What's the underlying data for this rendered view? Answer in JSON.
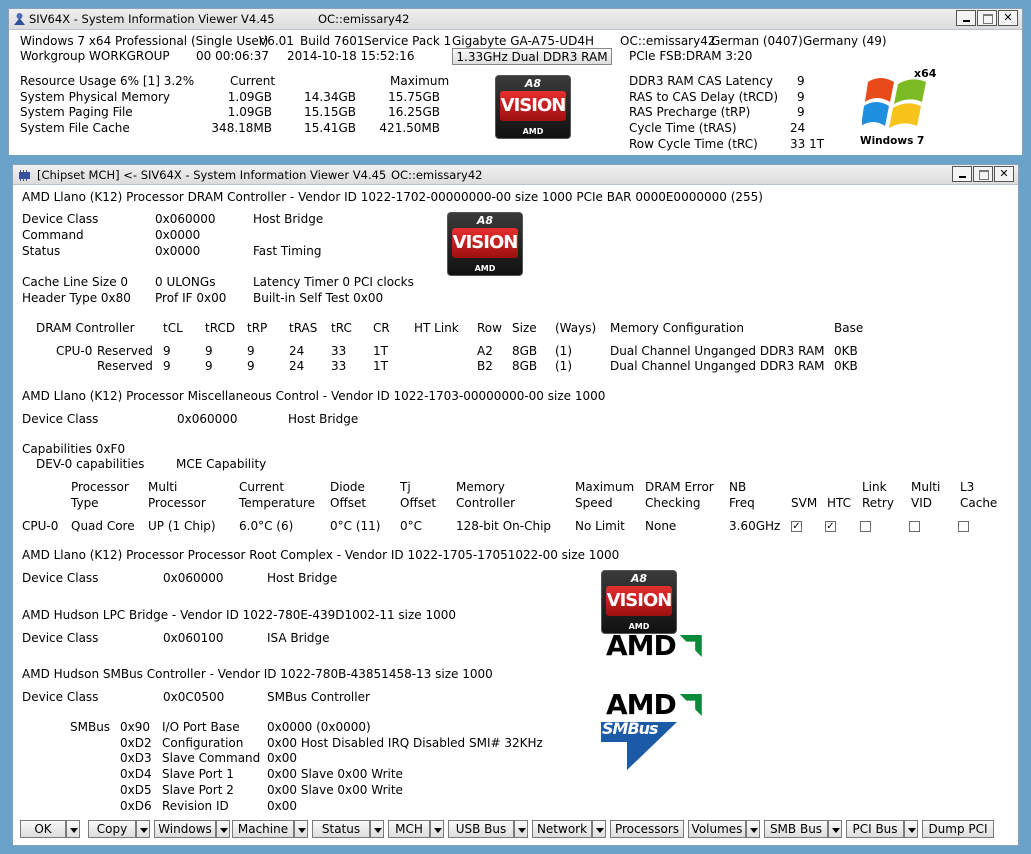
{
  "main_window": {
    "title": "SIV64X - System Information Viewer V4.45",
    "title_oc": "OC::emissary42",
    "os": "Windows 7 x64 Professional (Single User)",
    "version": "V6.01",
    "build": "Build 7601",
    "sp": "Service Pack 1",
    "board": "Gigabyte GA-A75-UD4H",
    "oc_user": "OC::emissary42",
    "lang": "German (0407)",
    "country": "Germany (49)",
    "workgroup": "Workgroup WORKGROUP",
    "uptime": "00 00:06:37",
    "date": "2014-10-18 15:52:16",
    "ram_button": "1.33GHz Dual DDR3 RAM",
    "pcie": "PCIe FSB:DRAM 3:20",
    "res_usage": "Resource Usage 6% [1] 3.2%",
    "hdr_current": "Current",
    "hdr_maximum": "Maximum",
    "mem_rows": [
      {
        "label": "System Physical Memory",
        "cur": "1.09GB",
        "mid": "14.34GB",
        "max": "15.75GB"
      },
      {
        "label": "System Paging File",
        "cur": "1.09GB",
        "mid": "15.15GB",
        "max": "16.25GB"
      },
      {
        "label": "System File Cache",
        "cur": "348.18MB",
        "mid": "15.41GB",
        "max": "421.50MB"
      }
    ],
    "timings": [
      {
        "label": "DDR3 RAM CAS Latency",
        "value": "9"
      },
      {
        "label": "RAS to CAS Delay (tRCD)",
        "value": "9"
      },
      {
        "label": "RAS Precharge (tRP)",
        "value": "9"
      },
      {
        "label": "Cycle Time (tRAS)",
        "value": "24"
      },
      {
        "label": "Row Cycle Time (tRC)",
        "value": "33 1T"
      }
    ],
    "win7_x64": "x64",
    "win7_label": "Windows 7"
  },
  "logos": {
    "a8": "A8",
    "vision": "VISION",
    "amd_small": "AMD",
    "amd": "AMD",
    "smbus": "SMBus"
  },
  "child_window": {
    "title": "[Chipset MCH] <- SIV64X - System Information Viewer V4.45",
    "title_oc": "OC::emissary42",
    "dram_header": "AMD Llano (K12) Processor DRAM Controller - Vendor ID 1022-1702-00000000-00  size 1000  PCIe BAR 0000E0000000 (255)",
    "dram_fields": [
      {
        "label": "Device Class",
        "value": "0x060000",
        "desc": "Host Bridge"
      },
      {
        "label": "Command",
        "value": "0x0000",
        "desc": ""
      },
      {
        "label": "Status",
        "value": "0x0000",
        "desc": "Fast Timing"
      }
    ],
    "cache_line": "Cache Line Size 0",
    "ulongs": "0 ULONGs",
    "latency_timer": "Latency Timer 0 PCI clocks",
    "header_type": "Header Type 0x80",
    "prof_if": "Prof IF 0x00",
    "bist": "Built-in Self Test 0x00",
    "dram_table": {
      "headers": [
        "DRAM Controller",
        "tCL",
        "tRCD",
        "tRP",
        "tRAS",
        "tRC",
        "CR",
        "HT Link",
        "Row",
        "Size",
        "(Ways)",
        "Memory Configuration",
        "Base"
      ],
      "cpu_label": "CPU-0",
      "rows": [
        [
          "Reserved",
          "9",
          "9",
          "9",
          "24",
          "33",
          "1T",
          "A2",
          "8GB",
          "(1)",
          "Dual Channel Unganged DDR3 RAM",
          "0KB"
        ],
        [
          "Reserved",
          "9",
          "9",
          "9",
          "24",
          "33",
          "1T",
          "B2",
          "8GB",
          "(1)",
          "Dual Channel Unganged DDR3 RAM",
          "0KB"
        ]
      ]
    },
    "misc_header": "AMD Llano (K12) Processor Miscellaneous Control - Vendor ID 1022-1703-00000000-00  size 1000",
    "misc_devclass": {
      "label": "Device Class",
      "value": "0x060000",
      "desc": "Host Bridge"
    },
    "capabilities": "Capabilities 0xF0",
    "dev0_caps": "DEV-0 capabilities",
    "mce_cap": "MCE Capability",
    "proc_headers": [
      [
        "",
        ""
      ],
      [
        "Processor",
        "Type"
      ],
      [
        "Multi",
        "Processor"
      ],
      [
        "Current",
        "Temperature"
      ],
      [
        "Diode",
        "Offset"
      ],
      [
        "Tj",
        "Offset"
      ],
      [
        "Memory",
        "Controller"
      ],
      [
        "Maximum",
        "Speed"
      ],
      [
        "DRAM Error",
        "Checking"
      ],
      [
        "NB",
        "Freq"
      ],
      [
        "",
        "SVM"
      ],
      [
        "",
        "HTC"
      ],
      [
        "Link",
        "Retry"
      ],
      [
        "Multi",
        "VID"
      ],
      [
        "L3",
        "Cache"
      ]
    ],
    "proc_row": {
      "cpu": "CPU-0",
      "type": "Quad Core",
      "multi": "UP (1 Chip)",
      "temp": "6.0°C (6)",
      "diode": "0°C (11)",
      "tj": "0°C",
      "memctl": "128-bit On-Chip",
      "maxspeed": "No Limit",
      "dramerr": "None",
      "nbfreq": "3.60GHz",
      "svm": true,
      "htc": true,
      "link_retry": false,
      "multi_vid": false,
      "l3": false
    },
    "root_header": "AMD Llano (K12) Processor Processor Root Complex - Vendor ID 1022-1705-17051022-00  size 1000",
    "root_devclass": {
      "label": "Device Class",
      "value": "0x060000",
      "desc": "Host Bridge"
    },
    "lpc_header": "AMD Hudson LPC Bridge - Vendor ID 1022-780E-439D1002-11  size 1000",
    "lpc_devclass": {
      "label": "Device Class",
      "value": "0x060100",
      "desc": "ISA Bridge"
    },
    "smbus_header": "AMD Hudson SMBus Controller - Vendor ID 1022-780B-43851458-13  size 1000",
    "smbus_devclass": {
      "label": "Device Class",
      "value": "0x0C0500",
      "desc": "SMBus Controller"
    },
    "smbus_label": "SMBus",
    "smbus_rows": [
      {
        "addr": "0x90",
        "name": "I/O Port Base",
        "value": "0x0000  (0x0000)"
      },
      {
        "addr": "0xD2",
        "name": "Configuration",
        "value": "0x00  Host Disabled  IRQ Disabled  SMI#  32KHz"
      },
      {
        "addr": "0xD3",
        "name": "Slave Command",
        "value": "0x00"
      },
      {
        "addr": "0xD4",
        "name": "Slave Port 1",
        "value": "0x00  Slave 0x00  Write"
      },
      {
        "addr": "0xD5",
        "name": "Slave Port 2",
        "value": "0x00  Slave 0x00  Write"
      },
      {
        "addr": "0xD6",
        "name": "Revision ID",
        "value": "0x00"
      }
    ]
  },
  "toolbar": {
    "buttons": [
      {
        "label": "OK",
        "dropdown": true
      },
      {
        "label": "Copy",
        "dropdown": true
      },
      {
        "label": "Windows",
        "dropdown": true
      },
      {
        "label": "Machine",
        "dropdown": true
      },
      {
        "label": "Status",
        "dropdown": true
      },
      {
        "label": "MCH",
        "dropdown": true
      },
      {
        "label": "USB Bus",
        "dropdown": true
      },
      {
        "label": "Network",
        "dropdown": true
      },
      {
        "label": "Processors",
        "dropdown": false
      },
      {
        "label": "Volumes",
        "dropdown": true
      },
      {
        "label": "SMB Bus",
        "dropdown": true
      },
      {
        "label": "PCI Bus",
        "dropdown": true
      },
      {
        "label": "Dump PCI",
        "dropdown": false
      }
    ]
  },
  "icons": [
    "siv-app-icon",
    "chip-icon",
    "minimize-icon",
    "maximize-icon",
    "close-icon",
    "dropdown-arrow-icon",
    "checkbox-icon",
    "windows7-logo-icon",
    "amd-logo-icon",
    "smbus-logo-icon"
  ]
}
